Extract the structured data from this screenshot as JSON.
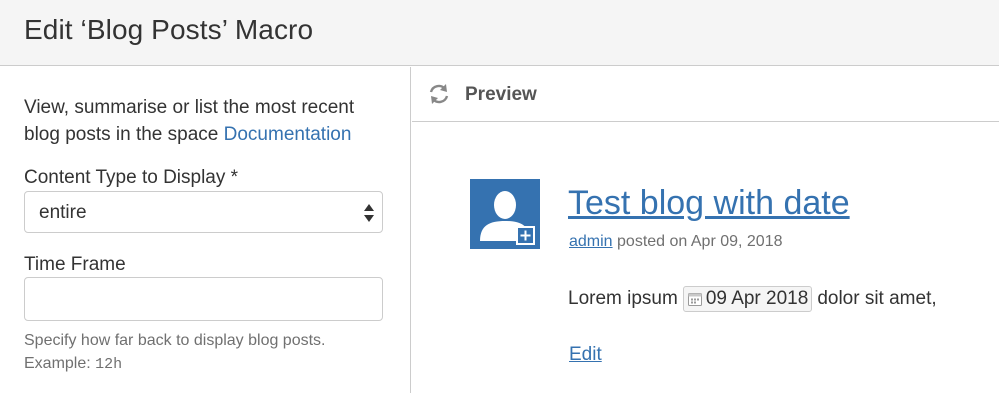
{
  "dialog": {
    "title": "Edit ‘Blog Posts’ Macro"
  },
  "form": {
    "description_prefix": "View, summarise or list the most recent blog posts in the space ",
    "description_link": "Documentation",
    "content_type_label": "Content Type to Display *",
    "content_type_value": "entire",
    "time_frame_label": "Time Frame",
    "time_frame_value": "",
    "help_text": "Specify how far back to display blog posts. Example: ",
    "help_example": "12h"
  },
  "preview": {
    "title": "Preview",
    "post": {
      "title": "Test blog with date",
      "author": "admin",
      "posted_text": " posted on Apr 09, 2018",
      "body_before": "Lorem ipsum",
      "date_lozenge": "09 Apr 2018",
      "body_after": "dolor sit amet,",
      "edit_link": "Edit"
    }
  },
  "icons": {
    "refresh": "refresh-icon",
    "avatar": "default-avatar-add-icon",
    "calendar": "calendar-icon",
    "select_arrows": "sort-arrows-icon"
  },
  "colors": {
    "link": "#3572b0",
    "header_bg": "#f5f5f5",
    "border": "#cccccc",
    "muted_text": "#707070"
  }
}
